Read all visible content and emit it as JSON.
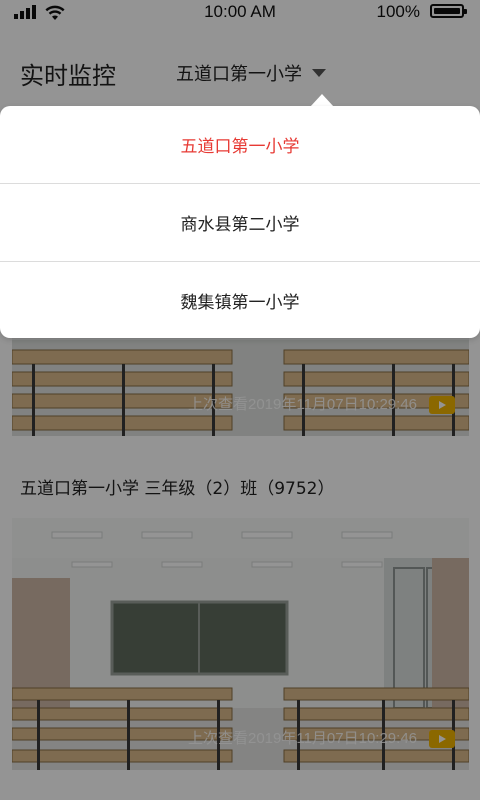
{
  "status_bar": {
    "time": "10:00 AM",
    "battery": "100%"
  },
  "header": {
    "title": "实时监控",
    "school": "五道口第一小学"
  },
  "dropdown": {
    "options": [
      "五道口第一小学",
      "商水县第二小学",
      "魏集镇第一小学"
    ],
    "selected_index": 0,
    "selected_color": "#e73a34"
  },
  "cameras": [
    {
      "last_viewed": "上次查看2019年11月07日10:29:46"
    },
    {
      "label": "五道口第一小学  三年级（2）班（9752）",
      "last_viewed": "上次查看2019年11月07日10:29:46"
    }
  ],
  "icons": [
    "signal-icon",
    "wifi-icon",
    "battery-icon",
    "caret-down-icon",
    "play-icon"
  ]
}
